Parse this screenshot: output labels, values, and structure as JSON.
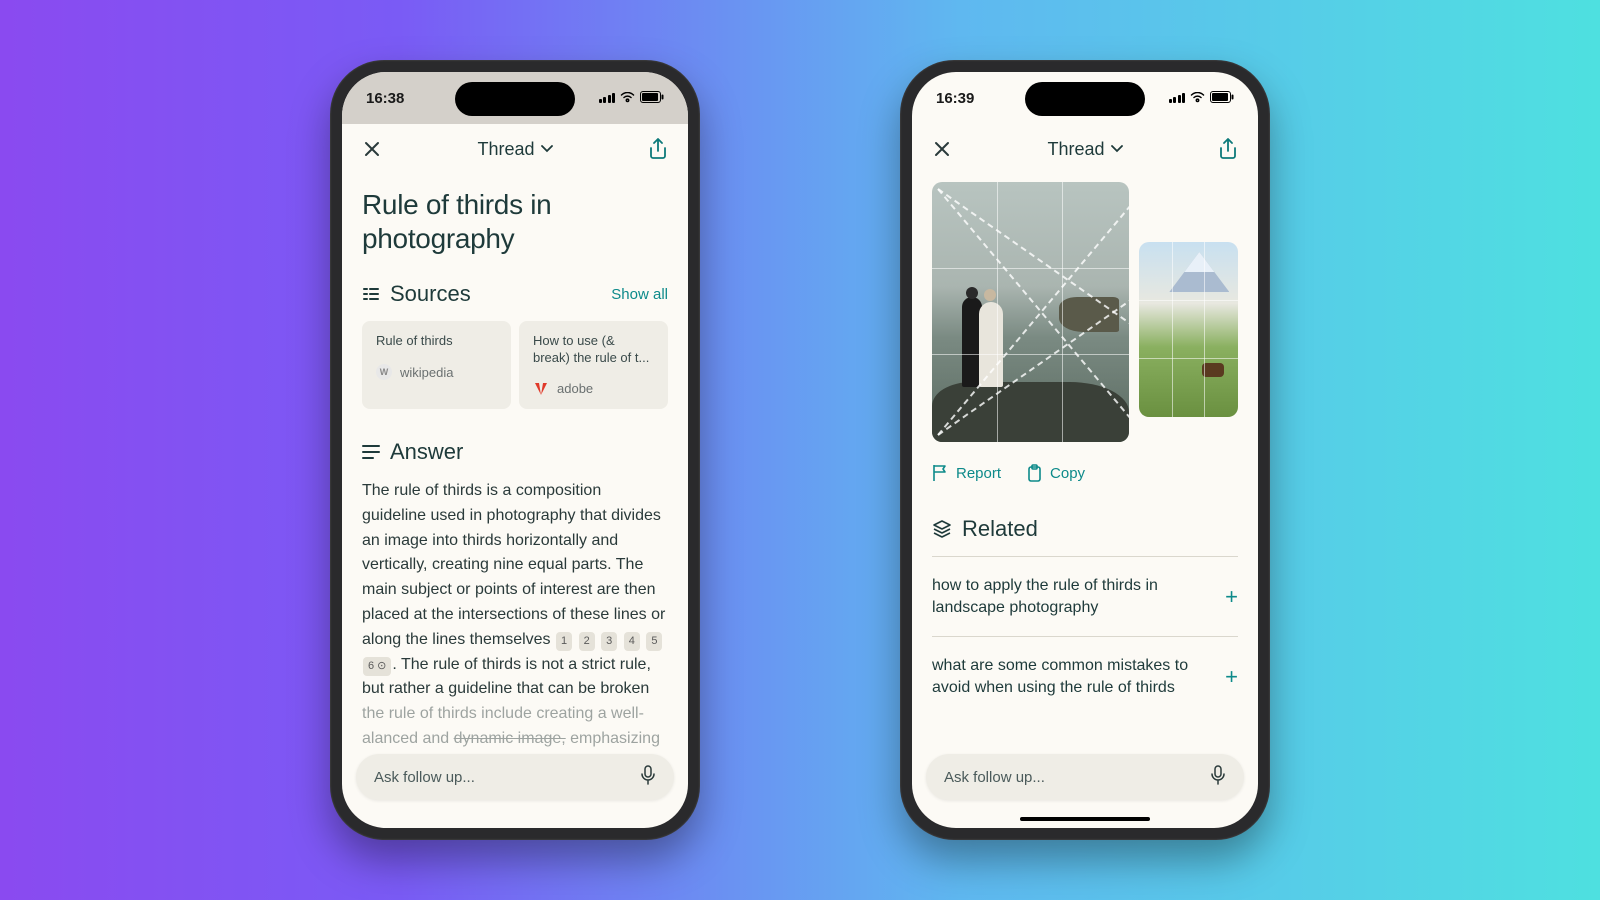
{
  "phone1": {
    "status": {
      "time": "16:38"
    },
    "nav": {
      "title": "Thread"
    },
    "title": "Rule of thirds in photography",
    "sources": {
      "header": "Sources",
      "show_all": "Show all",
      "cards": [
        {
          "title": "Rule of thirds",
          "source": "wikipedia",
          "favicon": "W"
        },
        {
          "title": "How to use (& break) the rule of t...",
          "source": "adobe",
          "favicon": "A"
        }
      ]
    },
    "answer": {
      "header": "Answer",
      "body_pre": "The rule of thirds is a composition guideline used in photography that divides an image into thirds horizontally and vertically, creating nine equal parts. The main subject or points of interest are then placed at the intersections of these lines or along the lines themselves ",
      "cites": [
        "1",
        "2",
        "3",
        "4",
        "5"
      ],
      "body_post_1": ". The rule of thirds is not a strict rule, but rather a guideline that can be broken",
      "body_post_2": "the rule of thirds include creating a well-",
      "body_post_3": "alanced and ",
      "struck": "dynamic image,",
      "body_post_4": " emphasizing",
      "cite_end": "6"
    },
    "followup": {
      "placeholder": "Ask follow up..."
    }
  },
  "phone2": {
    "status": {
      "time": "16:39"
    },
    "nav": {
      "title": "Thread"
    },
    "actions": {
      "report": "Report",
      "copy": "Copy"
    },
    "related": {
      "header": "Related",
      "items": [
        "how to apply the rule of thirds in landscape photography",
        "what are some common mistakes to avoid when using the rule of thirds"
      ]
    },
    "followup": {
      "placeholder": "Ask follow up..."
    }
  }
}
